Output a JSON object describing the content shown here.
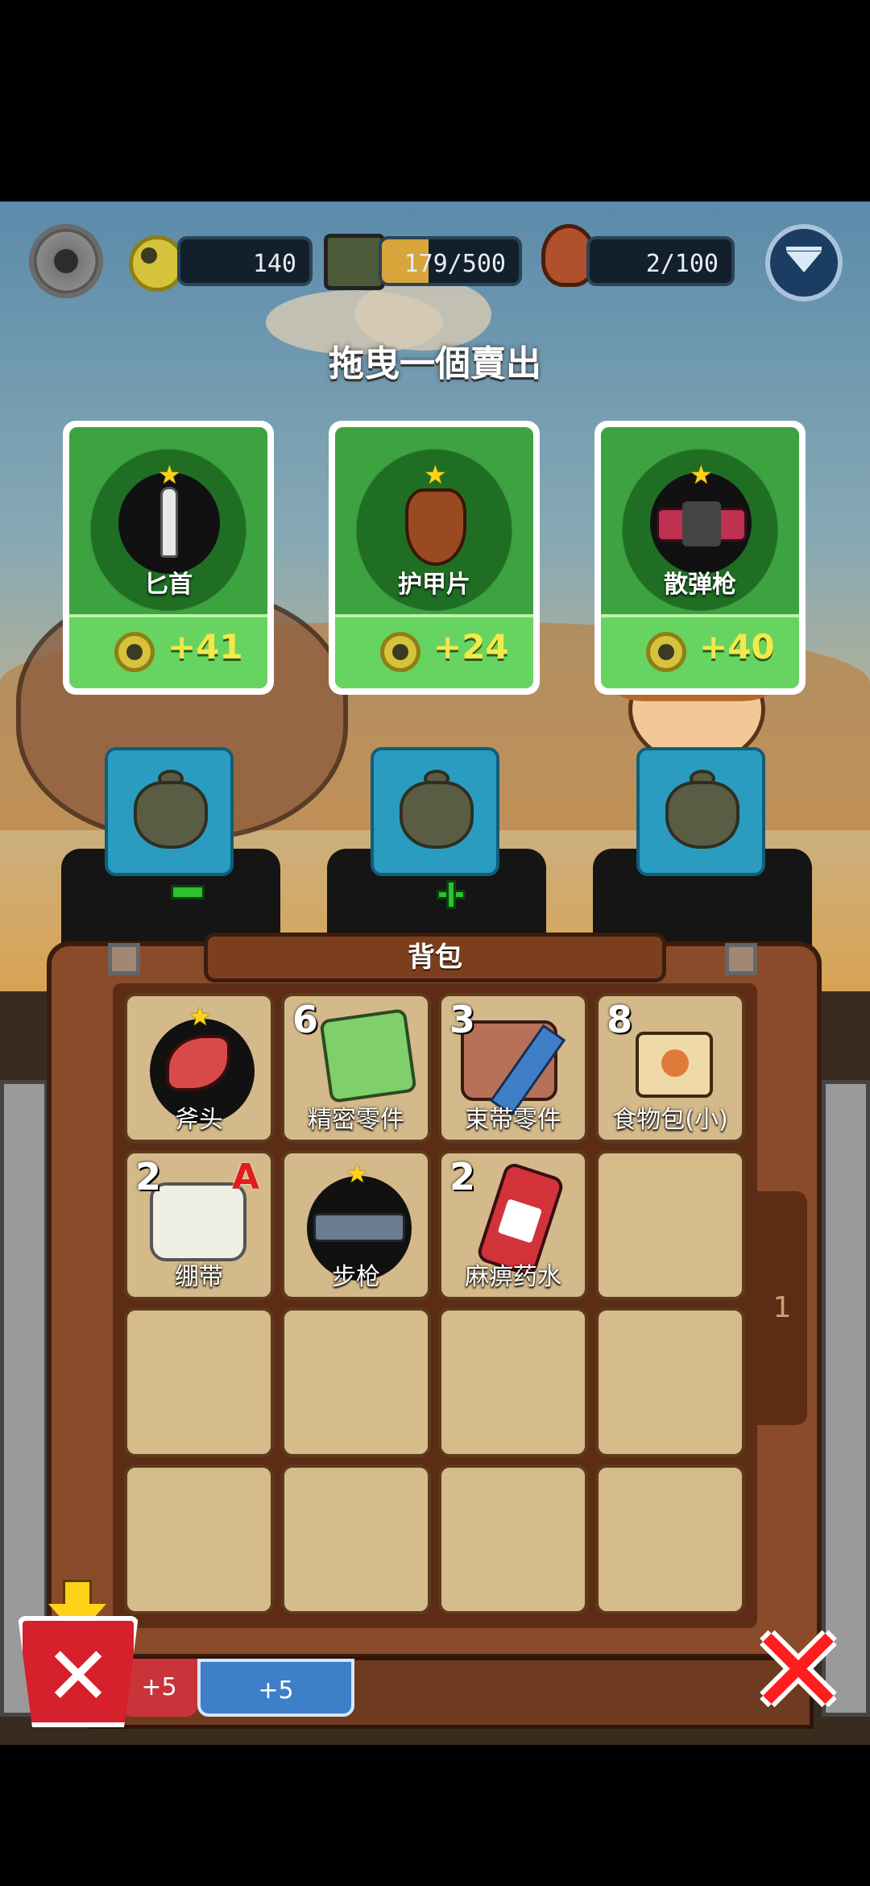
{
  "hud": {
    "bolts": "140",
    "supplies": "179/500",
    "food": "2/100"
  },
  "instruction": "拖曳一個賣出",
  "sell_cards": [
    {
      "name": "匕首",
      "price": "+41",
      "starred": true
    },
    {
      "name": "护甲片",
      "price": "+24",
      "starred": true
    },
    {
      "name": "散弹枪",
      "price": "+40",
      "starred": true
    }
  ],
  "backpack": {
    "title": "背包",
    "page": "1",
    "slots": [
      {
        "name": "斧头",
        "count": "",
        "starred": true,
        "tag": ""
      },
      {
        "name": "精密零件",
        "count": "6",
        "starred": false,
        "tag": ""
      },
      {
        "name": "束带零件",
        "count": "3",
        "starred": false,
        "tag": ""
      },
      {
        "name": "食物包(小)",
        "count": "8",
        "starred": false,
        "tag": ""
      },
      {
        "name": "绷带",
        "count": "2",
        "starred": false,
        "tag": "A"
      },
      {
        "name": "步枪",
        "count": "",
        "starred": true,
        "tag": ""
      },
      {
        "name": "麻痹药水",
        "count": "2",
        "starred": false,
        "tag": ""
      }
    ]
  },
  "bottom": {
    "bonus_left": "+5",
    "bonus_right": "+5"
  },
  "colors": {
    "card_green": "#48a848",
    "slot_tan": "#d4b98a",
    "frame_brown": "#8a4b2a",
    "bag_blue": "#2a9cbf"
  }
}
